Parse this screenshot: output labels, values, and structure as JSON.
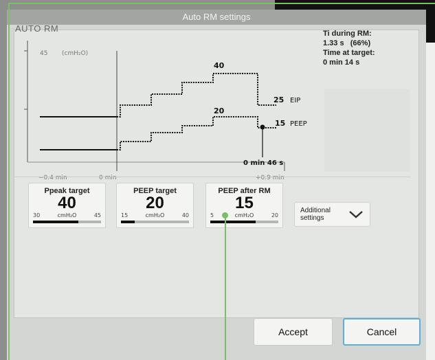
{
  "dialog": {
    "title": "Auto RM settings",
    "graph_title": "AUTO RM",
    "info": {
      "ti_label": "Ti during RM:",
      "ti_value": "1.33 s",
      "ti_pct": "(66%)",
      "time_label": "Time at target:",
      "time_value": "0 min 14 s"
    }
  },
  "graph": {
    "y_top_tick": "45",
    "y_unit": "(cmH₂O)",
    "x_labels": [
      "−0.4 min",
      "0 min",
      "+0.9 min"
    ],
    "peak_label": "40",
    "peep_peak_label": "20",
    "eip_value": "25",
    "eip_name": "EIP",
    "peep_value": "15",
    "peep_name": "PEEP",
    "duration_label": "0 min 46 s"
  },
  "controls": [
    {
      "label": "Ppeak target",
      "value": "40",
      "unit": "cmH₂O",
      "min": "30",
      "max": "45",
      "fill_fraction": 0.67
    },
    {
      "label": "PEEP target",
      "value": "20",
      "unit": "cmH₂O",
      "min": "15",
      "max": "40",
      "fill_fraction": 0.2
    },
    {
      "label": "PEEP after RM",
      "value": "15",
      "unit": "cmH₂O",
      "min": "5",
      "max": "20",
      "fill_fraction": 0.67
    }
  ],
  "additional_settings": {
    "label_line1": "Additional",
    "label_line2": "settings"
  },
  "buttons": {
    "accept": "Accept",
    "cancel": "Cancel"
  },
  "colors": {
    "annotation": "#7cbd6a",
    "cancel_border": "#5ab0d8",
    "dialog_bg": "#d4d6d3"
  }
}
